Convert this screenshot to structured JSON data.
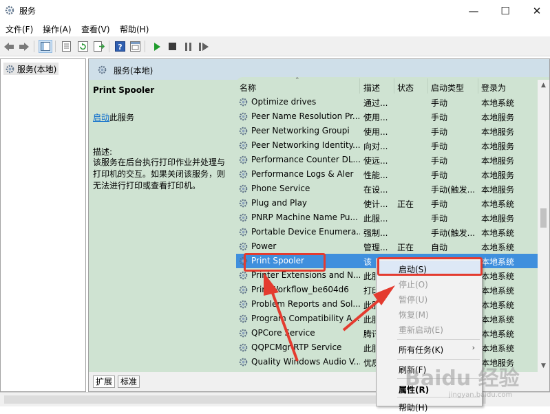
{
  "window": {
    "title": "服务",
    "controls": {
      "minimize": "—",
      "maximize": "☐",
      "close": "✕"
    }
  },
  "menubar": [
    "文件(F)",
    "操作(A)",
    "查看(V)",
    "帮助(H)"
  ],
  "toolbar_icons": [
    "back-icon",
    "forward-icon",
    "show-hide-tree-icon",
    "properties-icon",
    "refresh-icon",
    "export-list-icon",
    "help-icon",
    "console-icon",
    "start-service-icon",
    "stop-service-icon",
    "pause-service-icon",
    "restart-service-icon"
  ],
  "tree": {
    "root_label": "服务(本地)"
  },
  "pane": {
    "header_title": "服务(本地)",
    "detail": {
      "service_name": "Print Spooler",
      "start_link": "启动",
      "start_suffix": "此服务",
      "desc_label": "描述:",
      "desc_text": "该服务在后台执行打印作业并处理与打印机的交互。如果关闭该服务，则无法进行打印或查看打印机。"
    }
  },
  "columns": {
    "name": "名称",
    "desc": "描述",
    "state": "状态",
    "start_type": "启动类型",
    "logon": "登录为"
  },
  "services": [
    {
      "name": "Optimize drives",
      "desc": "通过...",
      "state": "",
      "start_type": "手动",
      "logon": "本地系统"
    },
    {
      "name": "Peer Name Resolution Pr...",
      "desc": "使用...",
      "state": "",
      "start_type": "手动",
      "logon": "本地服务"
    },
    {
      "name": "Peer Networking Groupi",
      "desc": "使用...",
      "state": "",
      "start_type": "手动",
      "logon": "本地服务"
    },
    {
      "name": "Peer Networking Identity...",
      "desc": "向对...",
      "state": "",
      "start_type": "手动",
      "logon": "本地服务"
    },
    {
      "name": "Performance Counter DL...",
      "desc": "使远...",
      "state": "",
      "start_type": "手动",
      "logon": "本地服务"
    },
    {
      "name": "Performance Logs & Aler",
      "desc": "性能...",
      "state": "",
      "start_type": "手动",
      "logon": "本地服务"
    },
    {
      "name": "Phone Service",
      "desc": "在设...",
      "state": "",
      "start_type": "手动(触发...",
      "logon": "本地服务"
    },
    {
      "name": "Plug and Play",
      "desc": "使计...",
      "state": "正在",
      "start_type": "手动",
      "logon": "本地系统"
    },
    {
      "name": "PNRP Machine Name Pu...",
      "desc": "此服...",
      "state": "",
      "start_type": "手动",
      "logon": "本地服务"
    },
    {
      "name": "Portable Device Enumera...",
      "desc": "强制...",
      "state": "",
      "start_type": "手动(触发...",
      "logon": "本地系统"
    },
    {
      "name": "Power",
      "desc": "管理...",
      "state": "正在",
      "start_type": "自动",
      "logon": "本地系统"
    },
    {
      "name": "Print Spooler",
      "desc": "该",
      "state": "",
      "start_type": "",
      "logon": "本地系统"
    },
    {
      "name": "Printer Extensions and N...",
      "desc": "此服",
      "state": "",
      "start_type": "",
      "logon": "本地系统"
    },
    {
      "name": "PrintWorkflow_be604d6",
      "desc": "打印",
      "state": "",
      "start_type": "",
      "logon": "本地系统"
    },
    {
      "name": "Problem Reports and Sol...",
      "desc": "此服",
      "state": "",
      "start_type": "",
      "logon": "本地系统"
    },
    {
      "name": "Program Compatibility A...",
      "desc": "此服",
      "state": "",
      "start_type": "",
      "logon": "本地系统"
    },
    {
      "name": "QPCore Service",
      "desc": "腾讯",
      "state": "",
      "start_type": "",
      "logon": "本地系统"
    },
    {
      "name": "QQPCMgr RTP Service",
      "desc": "此服",
      "state": "",
      "start_type": "",
      "logon": "本地系统"
    },
    {
      "name": "Quality Windows Audio V...",
      "desc": "优质",
      "state": "",
      "start_type": "",
      "logon": "本地服务"
    }
  ],
  "selected_service": "Print Spooler",
  "tabs": [
    "扩展",
    "标准"
  ],
  "context_menu": {
    "start": "启动(S)",
    "stop": "停止(O)",
    "pause": "暂停(U)",
    "resume": "恢复(M)",
    "restart": "重新启动(E)",
    "all_tasks": "所有任务(K)",
    "refresh": "刷新(F)",
    "properties": "属性(R)",
    "help": "帮助(H)"
  },
  "watermark": {
    "main": "Baidu 经验",
    "sub": "jingyan.baidu.com"
  },
  "colors": {
    "annotation_red": "#e43b2f",
    "selection_blue": "#3f8fdd",
    "list_bg": "#cfe3d2",
    "header_bg": "#cfdfe9"
  }
}
